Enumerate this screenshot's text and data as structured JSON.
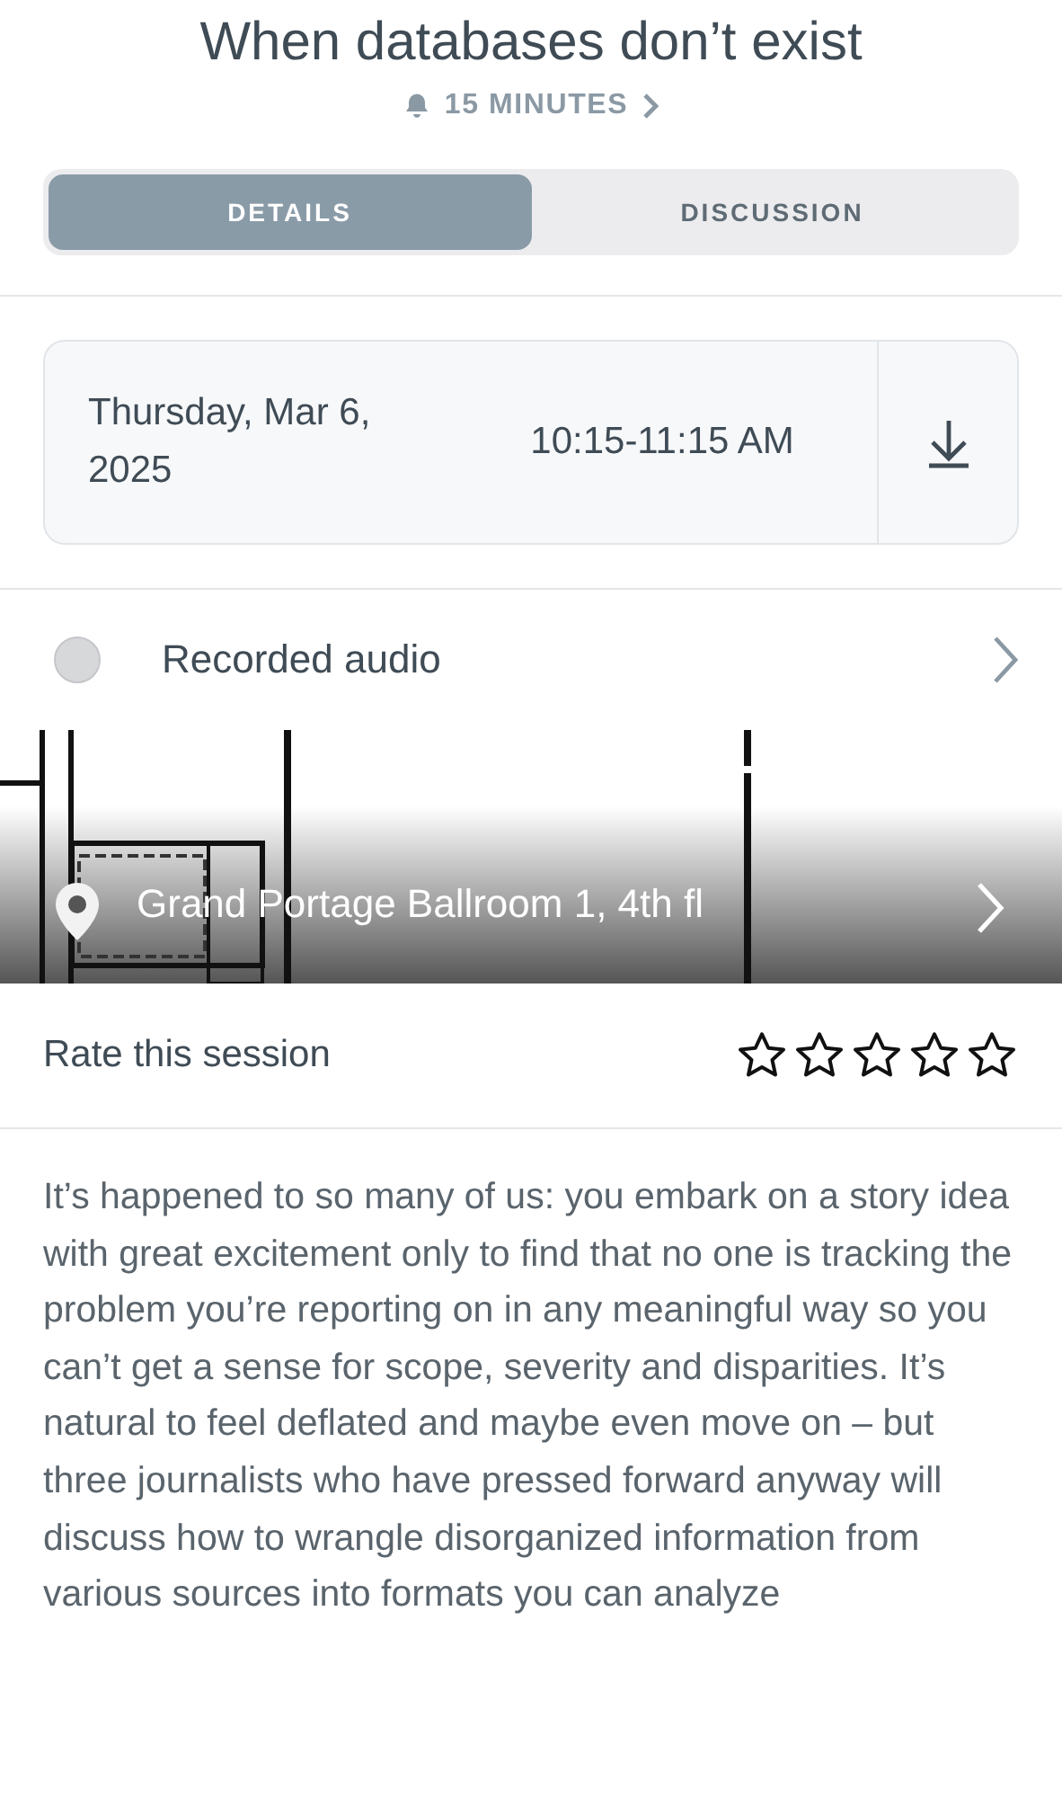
{
  "title": "When databases don’t exist",
  "reminder": {
    "label": "15 MINUTES"
  },
  "tabs": [
    {
      "label": "DETAILS",
      "selected": true
    },
    {
      "label": "DISCUSSION",
      "selected": false
    }
  ],
  "schedule": {
    "date": "Thursday, Mar 6, 2025",
    "time": "10:15-11:15 AM"
  },
  "audio": {
    "label": "Recorded audio"
  },
  "location": {
    "kind": "picture",
    "label": "Grand Portage Ballroom 1, 4th fl"
  },
  "rating": {
    "label": "Rate this session",
    "stars": 0
  },
  "description": "It’s happened to so many of us: you embark on a story idea with great excitement only to find that no one is tracking the problem you’re reporting on in any meaningful way so you can’t get a sense for scope, severity and disparities. It’s natural to feel deflated and maybe even move on – but three journalists who have pressed forward anyway will discuss how to wrangle disorganized information from various sources into formats you can analyze"
}
